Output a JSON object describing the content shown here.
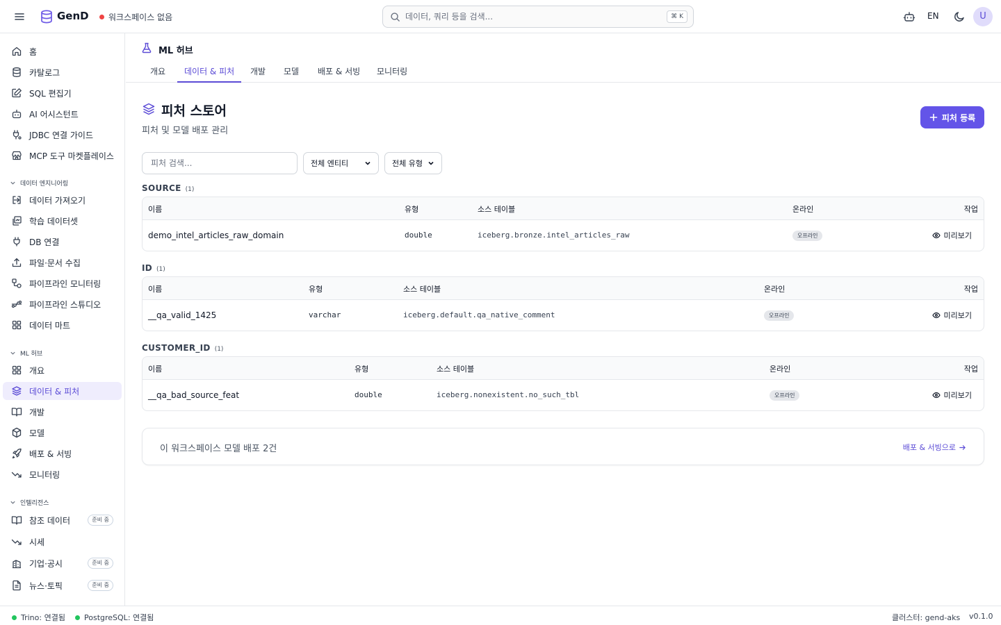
{
  "topbar": {
    "logo": "GenD",
    "workspace_status": "워크스페이스 없음",
    "search_placeholder": "데이터, 쿼리 등을 검색...",
    "search_shortcut": "⌘ K",
    "language": "EN",
    "avatar_initial": "U"
  },
  "sidebar": {
    "top_items": [
      {
        "label": "홈",
        "icon": "home-icon"
      },
      {
        "label": "카탈로그",
        "icon": "database-icon"
      },
      {
        "label": "SQL 편집기",
        "icon": "edit-icon"
      },
      {
        "label": "AI 어시스턴트",
        "icon": "bot-icon"
      },
      {
        "label": "JDBC 연결 가이드",
        "icon": "plug-icon"
      },
      {
        "label": "MCP 도구 마켓플레이스",
        "icon": "store-icon"
      }
    ],
    "sections": [
      {
        "title": "데이터 엔지니어링",
        "items": [
          {
            "label": "데이터 가져오기",
            "icon": "import-icon"
          },
          {
            "label": "학습 데이터셋",
            "icon": "dataset-icon"
          },
          {
            "label": "DB 연결",
            "icon": "plug-icon"
          },
          {
            "label": "파일·문서 수집",
            "icon": "upload-icon"
          },
          {
            "label": "파이프라인 모니터링",
            "icon": "pipeline-icon"
          },
          {
            "label": "파이프라인 스튜디오",
            "icon": "workflow-icon"
          },
          {
            "label": "데이터 마트",
            "icon": "grid-icon"
          }
        ]
      },
      {
        "title": "ML 허브",
        "items": [
          {
            "label": "개요",
            "icon": "grid-icon"
          },
          {
            "label": "데이터 & 피처",
            "icon": "layers-icon",
            "active": true
          },
          {
            "label": "개발",
            "icon": "book-icon"
          },
          {
            "label": "모델",
            "icon": "box-icon"
          },
          {
            "label": "배포 & 서빙",
            "icon": "rocket-icon"
          },
          {
            "label": "모니터링",
            "icon": "trend-down-icon"
          }
        ]
      },
      {
        "title": "인텔리전스",
        "items": [
          {
            "label": "참조 데이터",
            "icon": "book-icon",
            "badge": "준비 중"
          },
          {
            "label": "시세",
            "icon": "trend-down-icon"
          },
          {
            "label": "기업·공시",
            "icon": "building-icon",
            "badge": "준비 중"
          },
          {
            "label": "뉴스·토픽",
            "icon": "file-text-icon",
            "badge": "준비 중"
          }
        ]
      }
    ]
  },
  "main": {
    "hub_title": "ML 허브",
    "tabs": [
      {
        "label": "개요"
      },
      {
        "label": "데이터 & 피처",
        "active": true
      },
      {
        "label": "개발"
      },
      {
        "label": "모델"
      },
      {
        "label": "배포 & 서빙"
      },
      {
        "label": "모니터링"
      }
    ],
    "page_title": "피처 스토어",
    "page_subtitle": "피처 및 모델 배포 관리",
    "add_button": "피처 등록",
    "filter_search_placeholder": "피처 검색...",
    "entity_select": "전체 엔티티",
    "type_select": "전체 유형",
    "columns": {
      "name": "이름",
      "type": "유형",
      "source": "소스 테이블",
      "online": "온라인",
      "action": "작업"
    },
    "groups": [
      {
        "label": "SOURCE",
        "count": "(1)",
        "rows": [
          {
            "name": "demo_intel_articles_raw_domain",
            "type": "double",
            "source": "iceberg.bronze.intel_articles_raw",
            "online": "오프라인",
            "action": "미리보기"
          }
        ]
      },
      {
        "label": "ID",
        "count": "(1)",
        "rows": [
          {
            "name": "__qa_valid_1425",
            "type": "varchar",
            "source": "iceberg.default.qa_native_comment",
            "online": "오프라인",
            "action": "미리보기"
          }
        ]
      },
      {
        "label": "CUSTOMER_ID",
        "count": "(1)",
        "rows": [
          {
            "name": "__qa_bad_source_feat",
            "type": "double",
            "source": "iceberg.nonexistent.no_such_tbl",
            "online": "오프라인",
            "action": "미리보기"
          }
        ]
      }
    ],
    "deploy_summary": "이 워크스페이스 모델 배포 2건",
    "deploy_link": "배포 & 서빙으로"
  },
  "statusbar": {
    "trino": "Trino: 연결됨",
    "postgres": "PostgreSQL: 연결됨",
    "cluster": "클러스터: gend-aks",
    "version": "v0.1.0"
  },
  "colors": {
    "accent": "#6354e8",
    "connected": "#22c55e",
    "no_workspace": "#ef4444"
  }
}
